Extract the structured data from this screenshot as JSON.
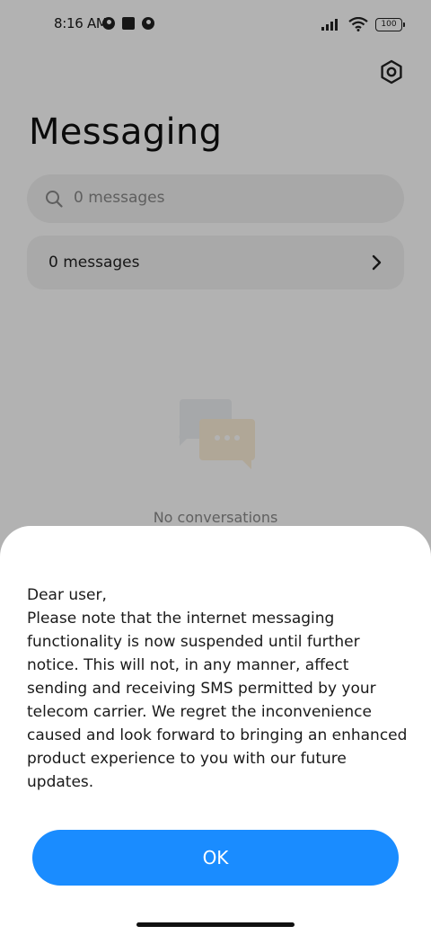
{
  "status_bar": {
    "time": "8:16 AM",
    "battery": "100",
    "left_icons": [
      "app-notification-icon",
      "square-notification-icon",
      "app-notification-icon"
    ],
    "right_icons": [
      "signal-icon",
      "wifi-icon",
      "battery-icon"
    ]
  },
  "header": {
    "title": "Messaging",
    "settings_icon": "settings-hexagon-icon"
  },
  "search": {
    "placeholder": "0 messages"
  },
  "messages_row": {
    "label": "0 messages"
  },
  "empty_state": {
    "text": "No conversations",
    "illustration": "chat-bubbles-illustration"
  },
  "dialog": {
    "message": "Dear user,\nPlease note that the internet messaging functionality is now suspended until further notice. This will not, in any manner, affect sending and receiving SMS permitted by your telecom carrier. We regret the inconvenience caused and look forward to bringing an enhanced product experience to you with our future updates.",
    "ok_label": "OK"
  },
  "colors": {
    "accent": "#1a8cff",
    "background": "#ffffff",
    "overlay": "rgba(0,0,0,0.30)"
  }
}
